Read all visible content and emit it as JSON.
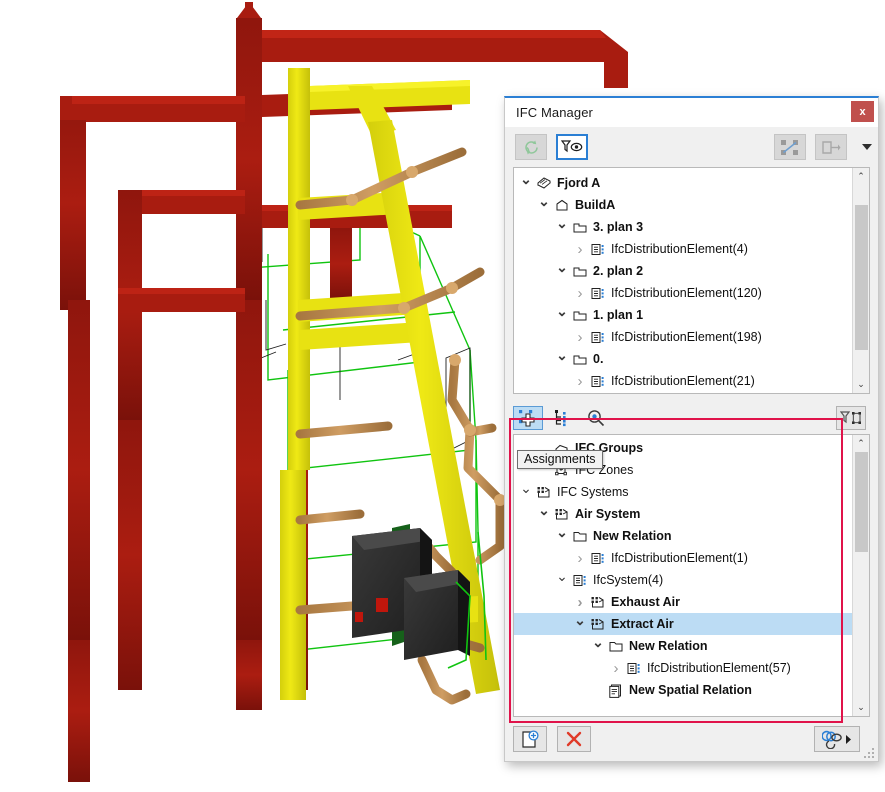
{
  "window": {
    "title": "IFC Manager",
    "close_label": "x"
  },
  "top_toolbar": {
    "refresh_icon": "refresh-circular-icon",
    "filter_eye_icon": "filter-visibility-icon",
    "assign_geometry_icon": "assign-geometry-icon",
    "relation_icon": "relation-arrow-icon",
    "overflow_icon": "chevron-down-icon"
  },
  "top_tree": {
    "rows": [
      {
        "indent": 0,
        "chev": "down",
        "icon": "project-icon",
        "label": "Fjord A",
        "count": "",
        "bold": true,
        "selected": false
      },
      {
        "indent": 1,
        "chev": "down",
        "icon": "building-icon",
        "label": "BuildA",
        "count": "",
        "bold": true,
        "selected": false
      },
      {
        "indent": 2,
        "chev": "down",
        "icon": "storey-icon",
        "label": "3. plan 3",
        "count": "",
        "bold": true,
        "selected": false
      },
      {
        "indent": 3,
        "chev": "right",
        "icon": "ifc-element-icon",
        "label": "IfcDistributionElement",
        "count": "(4)",
        "bold": false,
        "selected": false
      },
      {
        "indent": 2,
        "chev": "down",
        "icon": "storey-icon",
        "label": "2. plan 2",
        "count": "",
        "bold": true,
        "selected": false
      },
      {
        "indent": 3,
        "chev": "right",
        "icon": "ifc-element-icon",
        "label": "IfcDistributionElement",
        "count": "(120)",
        "bold": false,
        "selected": false
      },
      {
        "indent": 2,
        "chev": "down",
        "icon": "storey-icon",
        "label": "1. plan 1",
        "count": "",
        "bold": true,
        "selected": false
      },
      {
        "indent": 3,
        "chev": "right",
        "icon": "ifc-element-icon",
        "label": "IfcDistributionElement",
        "count": "(198)",
        "bold": false,
        "selected": false
      },
      {
        "indent": 2,
        "chev": "down",
        "icon": "storey-icon",
        "label": "0.",
        "count": "",
        "bold": true,
        "selected": false
      },
      {
        "indent": 3,
        "chev": "right",
        "icon": "ifc-element-icon",
        "label": "IfcDistributionElement",
        "count": "(21)",
        "bold": false,
        "selected": false
      }
    ]
  },
  "mid_toolbar": {
    "assignments_icon": "assignments-icon",
    "assignments_tooltip": "Assignments",
    "classification_icon": "tree-list-icon",
    "search_icon": "search-icon",
    "filter_select_icon": "filter-selection-icon"
  },
  "bottom_tree": {
    "rows": [
      {
        "indent": 1,
        "chev": "blank",
        "icon": "ifc-group-icon",
        "label": "IFC Groups",
        "count": "",
        "bold": true,
        "selected": false
      },
      {
        "indent": 1,
        "chev": "blank",
        "icon": "ifc-zone-icon",
        "label": "IFC Zones",
        "count": "",
        "bold": false,
        "selected": false
      },
      {
        "indent": 0,
        "chev": "down",
        "icon": "ifc-system-icon",
        "label": "IFC Systems",
        "count": "",
        "bold": false,
        "selected": false
      },
      {
        "indent": 1,
        "chev": "down",
        "icon": "ifc-system-icon",
        "label": "Air System",
        "count": "",
        "bold": true,
        "selected": false
      },
      {
        "indent": 2,
        "chev": "down",
        "icon": "folder-icon",
        "label": "New Relation",
        "count": "",
        "bold": true,
        "selected": false
      },
      {
        "indent": 3,
        "chev": "right",
        "icon": "ifc-element-icon",
        "label": "IfcDistributionElement",
        "count": "(1)",
        "bold": false,
        "selected": false
      },
      {
        "indent": 2,
        "chev": "down",
        "icon": "ifc-element-icon",
        "label": "IfcSystem",
        "count": "(4)",
        "bold": false,
        "selected": false
      },
      {
        "indent": 3,
        "chev": "right",
        "icon": "ifc-system-icon",
        "label": "Exhaust Air",
        "count": "",
        "bold": true,
        "selected": false
      },
      {
        "indent": 3,
        "chev": "down",
        "icon": "ifc-system-icon",
        "label": "Extract Air",
        "count": "",
        "bold": true,
        "selected": true
      },
      {
        "indent": 4,
        "chev": "down",
        "icon": "folder-icon",
        "label": "New Relation",
        "count": "",
        "bold": true,
        "selected": false
      },
      {
        "indent": 5,
        "chev": "right",
        "icon": "ifc-element-icon",
        "label": "IfcDistributionElement",
        "count": "(57)",
        "bold": false,
        "selected": false
      },
      {
        "indent": 4,
        "chev": "blank",
        "icon": "spatial-relation-icon",
        "label": "New Spatial Relation",
        "count": "",
        "bold": true,
        "selected": false
      }
    ]
  },
  "bottom_bar": {
    "new_icon": "new-document-plus-icon",
    "delete_icon": "delete-x-icon",
    "settings_icon": "link-settings-icon",
    "settings_arrow_icon": "triangle-right-icon"
  },
  "colors": {
    "accent_blue": "#2b7fd4",
    "highlight_red": "#e0134a",
    "selection_blue": "#bcdcf4",
    "close_red": "#c0504d",
    "duct_supply": "#9e1a10",
    "duct_extract": "#e8e212",
    "pipe_brown": "#c08f5a",
    "zone_green": "#14c614",
    "equipment_black": "#2d2d2d"
  }
}
